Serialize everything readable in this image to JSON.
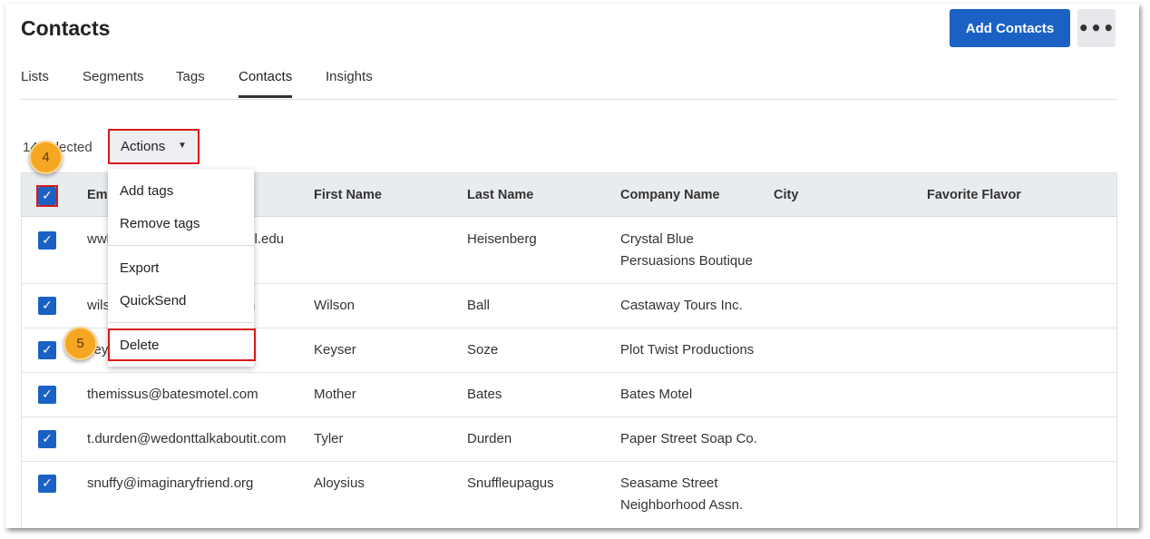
{
  "header": {
    "title": "Contacts",
    "add_contacts_label": "Add Contacts",
    "more_label": "•••"
  },
  "tabs": [
    {
      "label": "Lists"
    },
    {
      "label": "Segments"
    },
    {
      "label": "Tags"
    },
    {
      "label": "Contacts",
      "active": true
    },
    {
      "label": "Insights"
    }
  ],
  "toolbar": {
    "selected_text": "14 selected",
    "actions_label": "Actions"
  },
  "actions_menu": {
    "items": [
      "Add tags",
      "Remove tags",
      "Export",
      "QuickSend",
      "Delete"
    ]
  },
  "table": {
    "columns": [
      "Email",
      "First Name",
      "Last Name",
      "Company Name",
      "City",
      "Favorite Flavor"
    ],
    "rows": [
      {
        "email": "wwhite@jpwynnehighschool.edu",
        "first": "",
        "last": "Heisenberg",
        "company": "Crystal Blue Persuasions Boutique",
        "city": "",
        "flavor": ""
      },
      {
        "email": "wilson@castawaytours.com",
        "first": "Wilson",
        "last": "Ball",
        "company": "Castaway Tours Inc.",
        "city": "",
        "flavor": ""
      },
      {
        "email": "keyser@plottwist.com",
        "first": "Keyser",
        "last": "Soze",
        "company": "Plot Twist Productions",
        "city": "",
        "flavor": ""
      },
      {
        "email": "themissus@batesmotel.com",
        "first": "Mother",
        "last": "Bates",
        "company": "Bates Motel",
        "city": "",
        "flavor": ""
      },
      {
        "email": "t.durden@wedonttalkaboutit.com",
        "first": "Tyler",
        "last": "Durden",
        "company": "Paper Street Soap Co.",
        "city": "",
        "flavor": ""
      },
      {
        "email": "snuffy@imaginaryfriend.org",
        "first": "Aloysius",
        "last": "Snuffleupagus",
        "company": "Seasame Street Neighborhood Assn.",
        "city": "",
        "flavor": ""
      }
    ]
  },
  "steps": {
    "step4": "4",
    "step5": "5"
  },
  "icons": {
    "checkbox": "checkmark-icon",
    "actions_chevron": "chevron-down-icon",
    "more": "more-horizontal-icon"
  },
  "colors": {
    "primary": "#1b61c4",
    "highlight_red": "#d9181a",
    "step_orange": "#f5a623"
  }
}
